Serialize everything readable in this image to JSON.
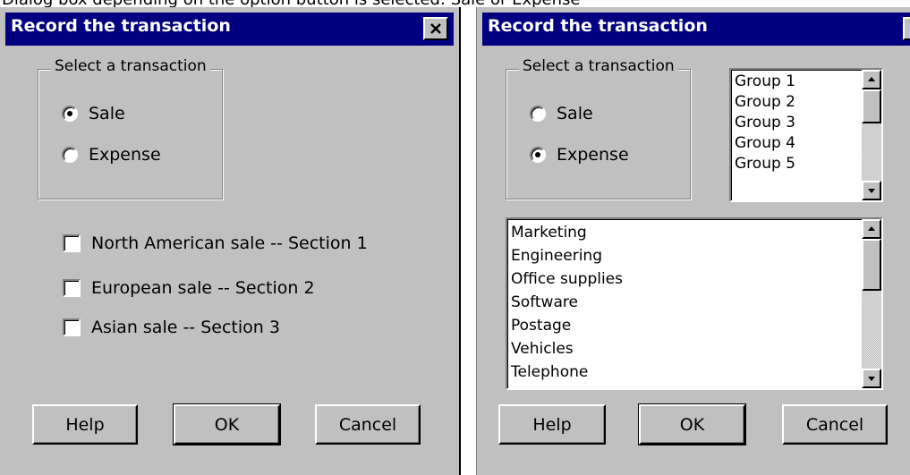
{
  "caption": "Dialog box depending on the option button is selected: Sale or Expense",
  "dialog_sale": {
    "title": "Record the transaction",
    "group_label": "Select a transaction",
    "radio_sale": "Sale",
    "radio_expense": "Expense",
    "selected": "Sale",
    "checkboxes": [
      "North American sale -- Section 1",
      "European sale -- Section 2",
      "Asian sale -- Section 3"
    ],
    "help": "Help",
    "ok": "OK",
    "cancel": "Cancel"
  },
  "dialog_expense": {
    "title": "Record the transaction",
    "group_label": "Select a transaction",
    "radio_sale": "Sale",
    "radio_expense": "Expense",
    "selected": "Expense",
    "groups": [
      "Group 1",
      "Group 2",
      "Group 3",
      "Group 4",
      "Group 5"
    ],
    "categories": [
      "Marketing",
      "Engineering",
      "Office supplies",
      "Software",
      "Postage",
      "Vehicles",
      "Telephone"
    ],
    "help": "Help",
    "ok": "OK",
    "cancel": "Cancel"
  },
  "colors": {
    "dialog_face": "#c0c0c0",
    "titlebar": "#000080",
    "title_text": "#ffffff"
  }
}
